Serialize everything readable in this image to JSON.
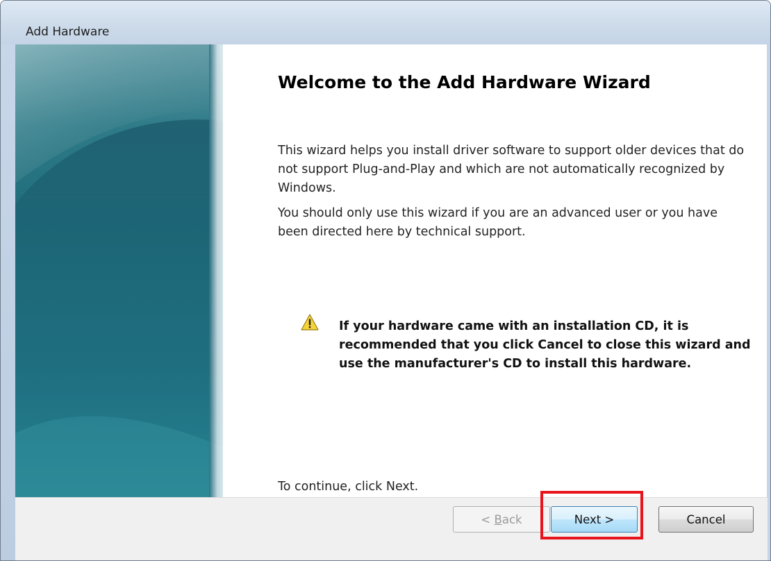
{
  "window": {
    "title": "Add Hardware"
  },
  "wizard": {
    "heading": "Welcome to the Add Hardware Wizard",
    "paragraph_1": "This wizard helps you install driver software to support older devices that do not support Plug-and-Play and which are not automatically recognized by Windows.",
    "paragraph_2": "You should only use this wizard if you are an advanced user or you have been directed here by technical support.",
    "warning": "If your hardware came with an installation CD, it is recommended that you click Cancel to close this wizard and use the manufacturer's CD to install this hardware.",
    "continue_text": "To continue, click Next."
  },
  "buttons": {
    "back": {
      "prefix": "< ",
      "accel": "B",
      "rest": "ack",
      "enabled": false
    },
    "next": {
      "label": "Next >",
      "enabled": true
    },
    "cancel": {
      "label": "Cancel",
      "enabled": true
    }
  },
  "icons": {
    "warning": "warning-icon"
  },
  "colors": {
    "highlight": "#e8141c",
    "banner": "#1d6a79"
  }
}
